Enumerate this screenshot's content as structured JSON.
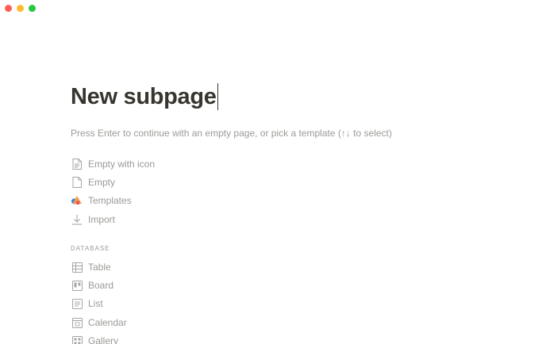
{
  "window": {
    "traffic_lights": [
      "close",
      "minimize",
      "maximize"
    ]
  },
  "page": {
    "title": "New subpage",
    "hint": "Press Enter to continue with an empty page, or pick a template (↑↓ to select)"
  },
  "options": [
    {
      "label": "Empty with icon",
      "icon": "page-with-text-icon"
    },
    {
      "label": "Empty",
      "icon": "page-icon"
    },
    {
      "label": "Templates",
      "icon": "templates-shapes-icon"
    },
    {
      "label": "Import",
      "icon": "import-arrow-icon"
    }
  ],
  "database": {
    "header": "DATABASE",
    "items": [
      {
        "label": "Table",
        "icon": "table-icon"
      },
      {
        "label": "Board",
        "icon": "board-icon"
      },
      {
        "label": "List",
        "icon": "list-icon"
      },
      {
        "label": "Calendar",
        "icon": "calendar-icon"
      },
      {
        "label": "Gallery",
        "icon": "gallery-icon"
      }
    ]
  },
  "colors": {
    "text_primary": "#37352f",
    "text_muted": "#9b9a97",
    "icon": "#a6a5a2"
  }
}
